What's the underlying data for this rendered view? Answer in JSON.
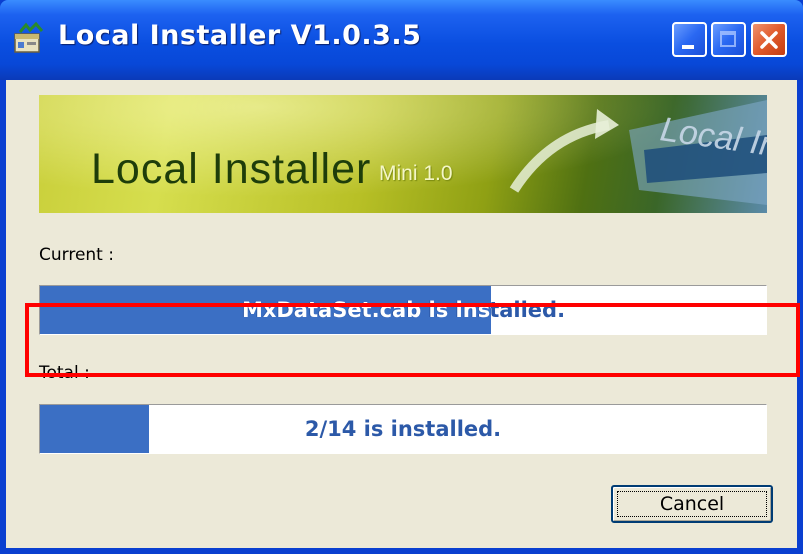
{
  "window": {
    "title": "Local Installer V1.0.3.5",
    "icon": "installer-app-icon",
    "controls": {
      "minimize_icon": "minimize-icon",
      "maximize_icon": "maximize-icon",
      "close_icon": "close-icon"
    }
  },
  "banner": {
    "title": "Local  Installer",
    "subtitle": "Mini 1.0",
    "logo_text": "Local Ins"
  },
  "current": {
    "label": "Current :",
    "status": "MxDataSet.cab is installed.",
    "progress_fraction": 0.62
  },
  "total": {
    "label": "Total :",
    "status": "2/14 is installed.",
    "progress_fraction": 0.15,
    "highlight_color": "#ff0000"
  },
  "buttons": {
    "cancel_label": "Cancel"
  },
  "colors": {
    "progress_fill": "#3b6fc4",
    "progress_text": "#2c59a8",
    "title_bar": "#0a4ee0",
    "dialog_bg": "#ece9d8"
  }
}
